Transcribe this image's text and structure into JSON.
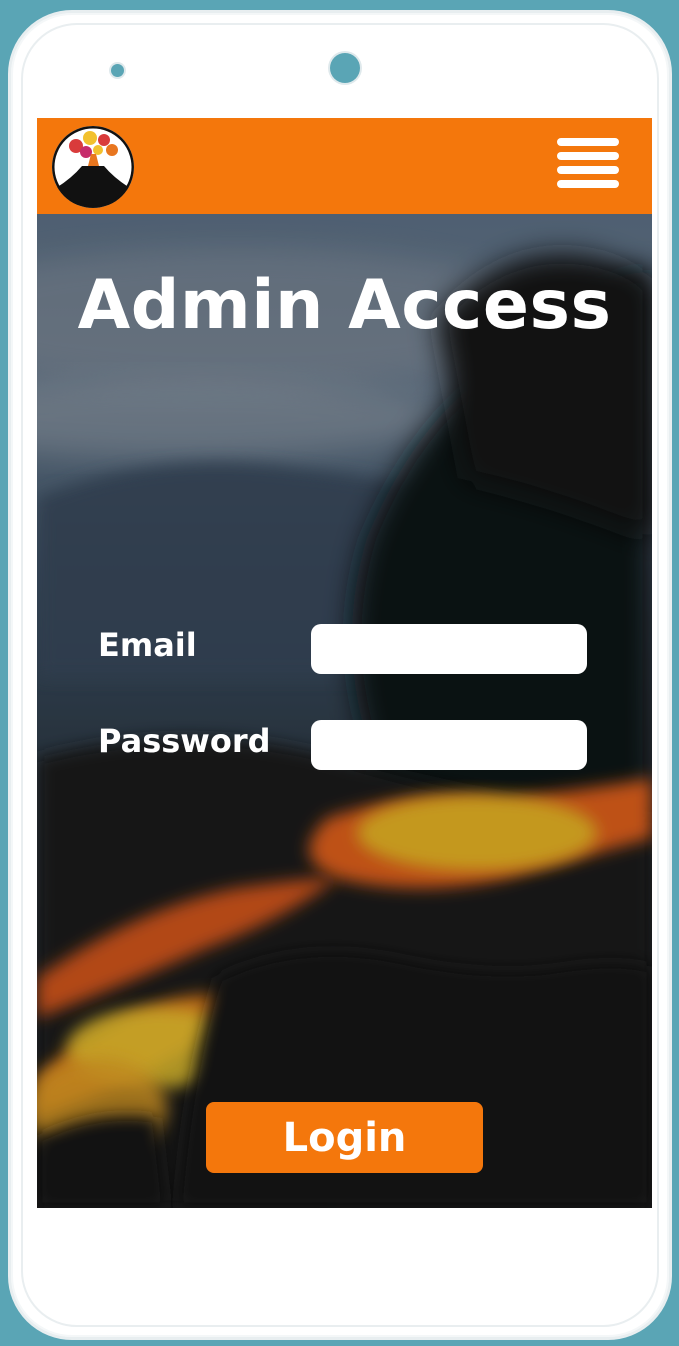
{
  "app": {
    "title": "Admin Access",
    "accent_color": "#f4770c",
    "device_bezel_color": "#5aa5b5"
  },
  "header": {
    "logo_icon": "volcano-logo-icon",
    "menu_icon": "hamburger-menu-icon"
  },
  "form": {
    "email_label": "Email",
    "email_value": "",
    "password_label": "Password",
    "password_value": "",
    "login_label": "Login"
  },
  "background": {
    "image": "blurred-volcano-lava-photo"
  }
}
